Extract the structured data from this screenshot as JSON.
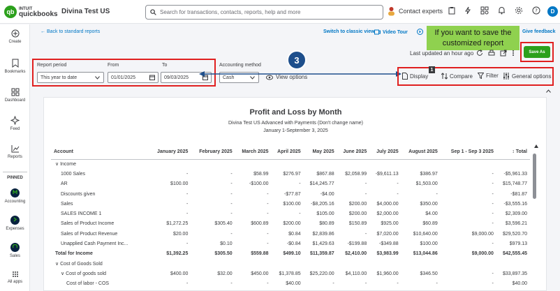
{
  "brand": {
    "logo_badge": "qb",
    "logo_line1": "INTUIT",
    "logo_line2": "quickbooks"
  },
  "header": {
    "company": "Divina Test US",
    "search_placeholder": "Search for transactions, contacts, reports, help and more",
    "contact": "Contact experts",
    "avatar": "D"
  },
  "sidebar": {
    "items": [
      {
        "label": "Create",
        "icon": "plus-circle-icon"
      },
      {
        "label": "Bookmarks",
        "icon": "bookmark-icon"
      },
      {
        "label": "Dashboard",
        "icon": "dashboard-icon"
      },
      {
        "label": "Feed",
        "icon": "feed-icon"
      },
      {
        "label": "Reports",
        "icon": "reports-icon"
      }
    ],
    "pinned_label": "PINNED",
    "pinned": [
      {
        "label": "Accounting"
      },
      {
        "label": "Expenses"
      },
      {
        "label": "Sales"
      }
    ],
    "all_apps": "All apps"
  },
  "toolbar": {
    "back": "← Back to standard reports",
    "switch_classic": "Switch to classic view",
    "video_tour": "Video Tour",
    "give_feedback": "Give feedback",
    "last_updated": "Last updated an hour ago",
    "save": "Save As"
  },
  "tooltip": {
    "text": "If you want to save the customized report"
  },
  "step_badge": "3",
  "filters": {
    "report_period_label": "Report period",
    "report_period_value": "This year to date",
    "from_label": "From",
    "from_value": "01/01/2025",
    "to_label": "To",
    "to_value": "09/03/2025",
    "method_label": "Accounting method",
    "method_value": "Cash",
    "view_options": "View options"
  },
  "actions": {
    "display": "Display",
    "display_badge": "1",
    "compare": "Compare",
    "filter": "Filter",
    "general": "General options"
  },
  "report": {
    "title": "Profit and Loss by Month",
    "subtitle": "Divina Test US Advanced with Payments (Don't change name)",
    "date_range": "January 1-September 3, 2025",
    "columns": [
      "Account",
      "January 2025",
      "February 2025",
      "March 2025",
      "April 2025",
      "May 2025",
      "June 2025",
      "July 2025",
      "August 2025",
      "Sep 1 - Sep 3 2025",
      "Total"
    ],
    "rows": [
      {
        "label": "∨  Income",
        "type": "section",
        "cells": [
          "",
          "",
          "",
          "",
          "",
          "",
          "",
          "",
          "",
          ""
        ]
      },
      {
        "label": "1000 Sales",
        "type": "row",
        "cells": [
          "-",
          "-",
          "$58.99",
          "$276.97",
          "$867.88",
          "$2,058.99",
          "-$9,611.13",
          "$386.97",
          "-",
          "-$5,961.33"
        ]
      },
      {
        "label": "AR",
        "type": "row",
        "cells": [
          "$100.00",
          "-",
          "-$100.00",
          "-",
          "$14,245.77",
          "-",
          "-",
          "$1,503.00",
          "-",
          "$15,748.77"
        ]
      },
      {
        "label": "Discounts given",
        "type": "row",
        "cells": [
          "-",
          "-",
          "-",
          "-$77.87",
          "-$4.00",
          "-",
          "-",
          "-",
          "-",
          "-$81.87"
        ]
      },
      {
        "label": "Sales",
        "type": "row",
        "cells": [
          "-",
          "-",
          "-",
          "$100.00",
          "-$8,205.16",
          "$200.00",
          "$4,000.00",
          "$350.00",
          "-",
          "-$3,555.16"
        ]
      },
      {
        "label": "SALES INCOME 1",
        "type": "row",
        "cells": [
          "-",
          "-",
          "-",
          "-",
          "$105.00",
          "$200.00",
          "$2,000.00",
          "$4.00",
          "-",
          "$2,309.00"
        ]
      },
      {
        "label": "Sales of Product Income",
        "type": "row",
        "cells": [
          "$1,272.25",
          "$305.40",
          "$600.89",
          "$200.00",
          "$80.89",
          "$150.89",
          "$925.00",
          "$60.89",
          "-",
          "$3,596.21"
        ]
      },
      {
        "label": "Sales of Product Revenue",
        "type": "row",
        "cells": [
          "$20.00",
          "-",
          "-",
          "$0.84",
          "$2,839.86",
          "-",
          "$7,020.00",
          "$10,640.00",
          "$9,000.00",
          "$29,520.70"
        ]
      },
      {
        "label": "Unapplied Cash Payment Inc...",
        "type": "row",
        "cells": [
          "-",
          "$0.10",
          "-",
          "-$0.84",
          "$1,429.63",
          "-$199.88",
          "-$349.88",
          "$100.00",
          "-",
          "$979.13"
        ]
      },
      {
        "label": "Total for Income",
        "type": "total",
        "cells": [
          "$1,392.25",
          "$305.50",
          "$559.88",
          "$499.10",
          "$11,359.87",
          "$2,410.00",
          "$3,983.99",
          "$13,044.86",
          "$9,000.00",
          "$42,555.45"
        ]
      },
      {
        "label": "∨  Cost of Goods Sold",
        "type": "section",
        "cells": [
          "",
          "",
          "",
          "",
          "",
          "",
          "",
          "",
          "",
          ""
        ]
      },
      {
        "label": "∨  Cost of goods sold",
        "type": "row",
        "cells": [
          "$400.00",
          "$32.00",
          "$450.00",
          "$1,378.85",
          "$25,220.00",
          "$4,110.00",
          "$1,960.00",
          "$346.50",
          "-",
          "$33,897.35"
        ]
      },
      {
        "label": "Cost of labor - COS",
        "type": "row",
        "cells": [
          "-",
          "-",
          "-",
          "$40.00",
          "-",
          "-",
          "-",
          "-",
          "-",
          "$40.00"
        ]
      }
    ]
  }
}
